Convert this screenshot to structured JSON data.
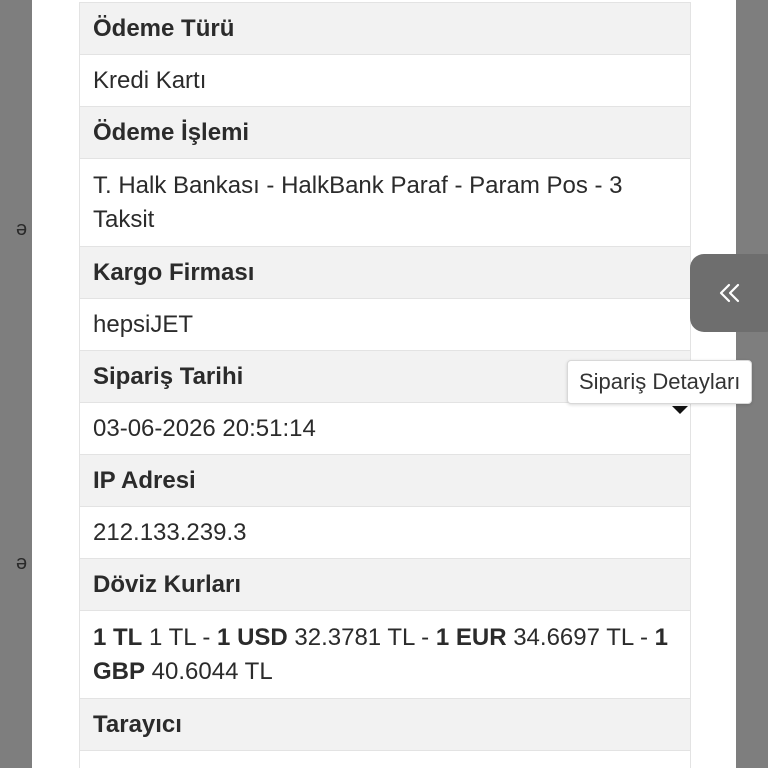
{
  "background": {
    "letters": [
      "ə",
      "ə"
    ]
  },
  "details": {
    "payment_type_label": "Ödeme Türü",
    "payment_type_value": "Kredi Kartı",
    "payment_process_label": "Ödeme İşlemi",
    "payment_process_value": "T. Halk Bankası - HalkBank Paraf - Param Pos - 3 Taksit",
    "cargo_label": "Kargo Firması",
    "cargo_value": "hepsiJET",
    "order_date_label": "Sipariş Tarihi",
    "order_date_value": "03-06-2026 20:51:14",
    "ip_label": "IP Adresi",
    "ip_value": "212.133.239.3",
    "fx_label": "Döviz Kurları",
    "fx": {
      "tl_code": "1 TL",
      "tl_value": " 1 TL - ",
      "usd_code": "1 USD",
      "usd_value": " 32.3781 TL - ",
      "eur_code": "1 EUR",
      "eur_value": " 34.6697 TL - ",
      "gbp_code": "1 GBP",
      "gbp_value": " 40.6044 TL"
    },
    "browser_label": "Tarayıcı"
  },
  "side_panel": {
    "icon": "double-chevron-left-icon",
    "tooltip": "Sipariş Detayları"
  },
  "colors": {
    "label_row_bg": "#f2f2f2",
    "border": "#e3e3e3",
    "overlay": "#7e7e7e",
    "side_button": "#6e6e6e"
  }
}
